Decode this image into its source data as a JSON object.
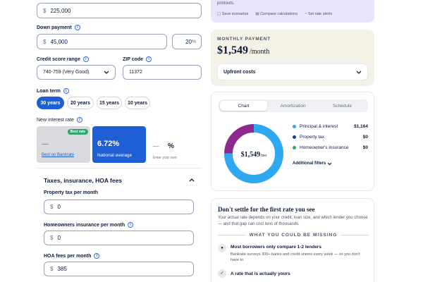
{
  "home_price": {
    "prefix": "$",
    "value": "225,000"
  },
  "down_payment": {
    "label": "Down payment",
    "prefix": "$",
    "value": "45,000",
    "percent": "20",
    "percent_suffix": "%"
  },
  "credit_score": {
    "label": "Credit score range",
    "value": "740-759 (Very Good)"
  },
  "zip_code": {
    "label": "ZIP code",
    "value": "11372"
  },
  "loan_term": {
    "label": "Loan term",
    "options": [
      "30 years",
      "20 years",
      "15 years",
      "10 years"
    ],
    "selected": "30 years"
  },
  "interest_rate": {
    "label": "New interest rate",
    "best": {
      "badge": "Best rate",
      "value": "—",
      "caption": "Best on Bankrate"
    },
    "national": {
      "value": "6.72%",
      "caption": "National average"
    },
    "own": {
      "value": "—",
      "suffix": "%",
      "caption": "Enter your own"
    }
  },
  "taxes_section": {
    "title": "Taxes, insurance, HOA fees",
    "property_tax": {
      "label": "Property tax per month",
      "prefix": "$",
      "value": "0"
    },
    "insurance": {
      "label": "Homeowners insurance per month",
      "prefix": "$",
      "value": "0"
    },
    "hoa": {
      "label": "HOA fees per month",
      "prefix": "$",
      "value": "385"
    }
  },
  "top_panel": {
    "text": "printouts.",
    "actions": [
      "Save scenarios",
      "Compare calculations",
      "Set rate alerts"
    ]
  },
  "monthly_payment": {
    "heading": "MONTHLY PAYMENT",
    "amount": "$1,549",
    "period": "/month",
    "upfront": "Upfront costs"
  },
  "chart_panel": {
    "tabs": [
      "Chart",
      "Amortization",
      "Schedule"
    ],
    "active_tab": "Chart",
    "center_amount": "$1,549",
    "center_period": "/mo",
    "additional_filters": "Additional filters"
  },
  "chart_data": {
    "type": "pie",
    "categories": [
      "Principal & interest",
      "Property tax",
      "Homeowner's insurance"
    ],
    "values": [
      1164,
      0,
      0
    ],
    "value_labels": [
      "$1,164",
      "$0",
      "$0"
    ],
    "colors": [
      "#2ea8f0",
      "#1e3a8a",
      "#2fa86b"
    ],
    "hoa_value": 385,
    "hoa_color": "#8e2a8e"
  },
  "tips": {
    "heading": "Don't settle for the first rate you see",
    "body": "Your actual rate depends on your credit, loan size, and which lender you choose — and that gap can cost tens of thousands.",
    "divider": "WHAT YOU COULD BE MISSING",
    "items": [
      {
        "title": "Most borrowers only compare 1-2 lenders",
        "text": "Bankrate surveys 300+ banks and credit unions every week — so you don't have to."
      },
      {
        "title": "A rate that is actually yours",
        "text": ""
      }
    ]
  }
}
